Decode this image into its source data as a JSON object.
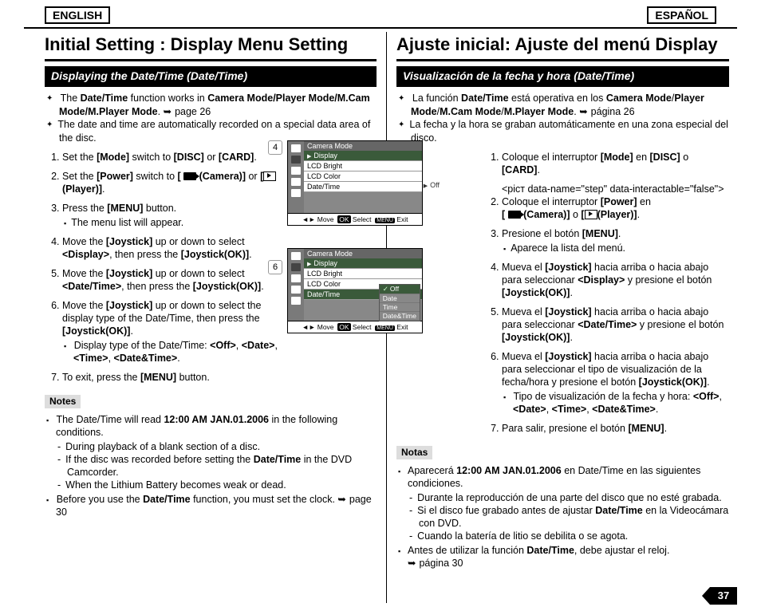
{
  "lang": {
    "en": "ENGLISH",
    "es": "ESPAÑOL"
  },
  "page_number": "37",
  "en": {
    "title": "Initial Setting : Display Menu Setting",
    "section": "Displaying the Date/Time (Date/Time)",
    "b1a": "The ",
    "b1b": "Date/Time",
    "b1c": " function works in ",
    "b1d": "Camera Mode/Player Mode/M.Cam Mode/M.Player Mode",
    "b1e": ". ",
    "b1f": "page 26",
    "b2": "The date and time are automatically recorded on a special data area of the disc.",
    "s1a": "Set the ",
    "s1b": "[Mode]",
    "s1c": " switch to ",
    "s1d": "[DISC]",
    "s1e": " or ",
    "s1f": "[CARD]",
    "s1g": ".",
    "s2a": "Set the ",
    "s2b": "[Power]",
    "s2c": " switch to ",
    "s2d": "[",
    "s2e": " (Camera)]",
    "s2f": " or ",
    "s2g": "[",
    "s2h": "(Player)]",
    "s2i": ".",
    "s3a": "Press the ",
    "s3b": "[MENU]",
    "s3c": " button.",
    "s3sub": "The menu list will appear.",
    "s4a": "Move the ",
    "s4b": "[Joystick]",
    "s4c": " up or down to select ",
    "s4d": "<Display>",
    "s4e": ", then press the ",
    "s4f": "[Joystick(OK)]",
    "s4g": ".",
    "s5a": "Move the ",
    "s5b": "[Joystick]",
    "s5c": " up or down to select ",
    "s5d": "<Date/Time>",
    "s5e": ", then press the ",
    "s5f": "[Joystick(OK)]",
    "s5g": ".",
    "s6a": "Move the ",
    "s6b": "[Joystick]",
    "s6c": " up or down to select the display type of the Date/Time, then press the ",
    "s6d": "[Joystick(OK)]",
    "s6e": ".",
    "s6sub1": "Display type of the Date/Time: ",
    "s6sub2": "<Off>",
    "s6sub3": ", ",
    "s6sub4": "<Date>",
    "s6sub5": ", ",
    "s6sub6": "<Time>",
    "s6sub7": ", ",
    "s6sub8": "<Date&Time>",
    "s6sub9": ".",
    "s7a": "To exit, press the ",
    "s7b": "[MENU]",
    "s7c": " button.",
    "notes": "Notes",
    "n1a": "The Date/Time will read ",
    "n1b": "12:00 AM JAN.01.2006",
    "n1c": " in the following conditions.",
    "n1d1": "During playback of a blank section of a disc.",
    "n1d2a": "If the disc was recorded before setting the ",
    "n1d2b": "Date/Time",
    "n1d2c": " in the DVD Camcorder.",
    "n1d3": "When the Lithium Battery becomes weak or dead.",
    "n2a": "Before you use the ",
    "n2b": "Date/Time",
    "n2c": " function, you must set the clock. ",
    "n2d": "page 30"
  },
  "es": {
    "title": "Ajuste inicial: Ajuste del menú Display",
    "section": "Visualización de la fecha y hora (Date/Time)",
    "b1a": "La función ",
    "b1b": "Date/Time",
    "b1c": " está operativa en los ",
    "b1d": "Camera Mode",
    "b1e": "/",
    "b1f": "Player Mode",
    "b1g": "/",
    "b1h": "M.Cam Mode",
    "b1i": "/",
    "b1j": "M.Player Mode",
    "b1k": ". ",
    "b1l": "página 26",
    "b2": "La fecha y la hora se graban automáticamente en una zona especial del disco.",
    "s1a": "Coloque el interruptor ",
    "s1b": "[Mode]",
    "s1c": " en ",
    "s1d": "[DISC]",
    "s1e": " o ",
    "s1f": "[CARD]",
    "s1g": ".",
    "s2a": "Coloque el interruptor ",
    "s2b": "[Power]",
    "s2c": " en ",
    "s2d": "[",
    "s2e": " (Camera)]",
    "s2f": " o ",
    "s2g": "[",
    "s2h": "(Player)]",
    "s2i": ".",
    "s3a": "Presione el botón ",
    "s3b": "[MENU]",
    "s3c": ".",
    "s3sub": "Aparece la lista del menú.",
    "s4a": "Mueva el ",
    "s4b": "[Joystick]",
    "s4c": " hacia arriba o hacia abajo para seleccionar ",
    "s4d": "<Display>",
    "s4e": " y presione el botón ",
    "s4f": "[Joystick(OK)]",
    "s4g": ".",
    "s5a": "Mueva el ",
    "s5b": "[Joystick]",
    "s5c": " hacia arriba o hacia abajo para seleccionar ",
    "s5d": "<Date/Time>",
    "s5e": " y presione el botón ",
    "s5f": "[Joystick(OK)]",
    "s5g": ".",
    "s6a": "Mueva el ",
    "s6b": "[Joystick]",
    "s6c": " hacia arriba o hacia abajo para seleccionar el tipo de visualización de la fecha/hora y presione el botón ",
    "s6d": "[Joystick(OK)]",
    "s6e": ".",
    "s6sub1": "Tipo de visualización de la fecha y hora: ",
    "s6sub2": "<Off>",
    "s6sub3": ", ",
    "s6sub4": "<Date>",
    "s6sub5": ", ",
    "s6sub6": "<Time>",
    "s6sub7": ", ",
    "s6sub8": "<Date&Time>",
    "s6sub9": ".",
    "s7a": "Para salir, presione el botón ",
    "s7b": "[MENU]",
    "s7c": ".",
    "notes": "Notas",
    "n1a": "Aparecerá ",
    "n1b": "12:00 AM JAN.01.2006",
    "n1c": " en Date/Time en las siguientes condiciones.",
    "n1d1": "Durante la reproducción de una parte del disco que no esté grabada.",
    "n1d2a": "Si el disco fue grabado antes de ajustar ",
    "n1d2b": "Date/Time",
    "n1d2c": " en la Videocámara con DVD.",
    "n1d3": "Cuando la batería de litio se debilita o se agota.",
    "n2a": "Antes de utilizar la función ",
    "n2b": "Date/Time",
    "n2c": ", debe ajustar el reloj. ",
    "n2d": "página 30"
  },
  "lcd": {
    "step4": "4",
    "step6": "6",
    "mode": "Camera Mode",
    "display": "Display",
    "lcd_bright": "LCD Bright",
    "lcd_color": "LCD Color",
    "date_time": "Date/Time",
    "off": "Off",
    "date": "Date",
    "time": "Time",
    "datetime": "Date&Time",
    "move": "Move",
    "select": "Select",
    "exit": "Exit",
    "ok": "OK",
    "menu": "MENU"
  }
}
